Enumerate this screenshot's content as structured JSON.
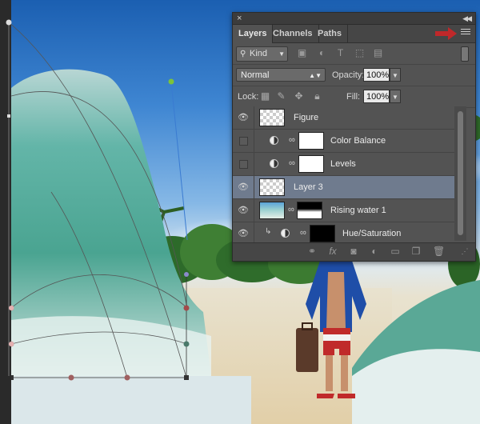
{
  "tabs": [
    {
      "label": "Layers",
      "active": true
    },
    {
      "label": "Channels",
      "active": false
    },
    {
      "label": "Paths",
      "active": false
    }
  ],
  "filter": {
    "kind_label": "Kind"
  },
  "blend": {
    "mode": "Normal",
    "opacity_label": "Opacity:",
    "opacity_value": "100%"
  },
  "lock": {
    "label": "Lock:",
    "fill_label": "Fill:",
    "fill_value": "100%"
  },
  "layers": [
    {
      "name": "Figure",
      "visible": true,
      "selected": false,
      "type": "pixel"
    },
    {
      "name": "Color Balance",
      "visible": false,
      "selected": false,
      "type": "adjustment"
    },
    {
      "name": "Levels",
      "visible": false,
      "selected": false,
      "type": "adjustment"
    },
    {
      "name": "Layer 3",
      "visible": true,
      "selected": true,
      "type": "smart"
    },
    {
      "name": "Rising water 1",
      "visible": true,
      "selected": false,
      "type": "masked"
    },
    {
      "name": "Hue/Saturation",
      "visible": true,
      "selected": false,
      "type": "adjustment-clipped"
    }
  ],
  "colors": {
    "panel": "#535353",
    "selected_row": "#6f7b8e",
    "annotation_red": "#c0282a"
  },
  "icons": [
    "close-icon",
    "collapse-icon",
    "panel-menu-icon",
    "search-icon",
    "image-filter-icon",
    "adjustment-filter-icon",
    "type-filter-icon",
    "shape-filter-icon",
    "smart-filter-icon",
    "eye-icon",
    "chain-link-icon",
    "link-layers-icon",
    "fx-icon",
    "add-mask-icon",
    "new-adjustment-icon",
    "new-group-icon",
    "new-layer-icon",
    "trash-icon"
  ]
}
